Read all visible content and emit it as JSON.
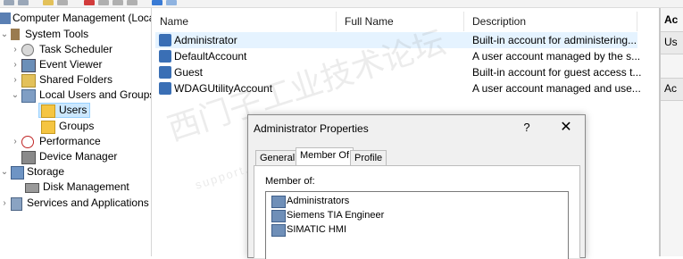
{
  "tree": {
    "root": "Computer Management (Local",
    "items": [
      {
        "label": "System Tools",
        "icon": "tools-icon"
      },
      {
        "label": "Task Scheduler",
        "icon": "clock-icon"
      },
      {
        "label": "Event Viewer",
        "icon": "event-viewer-icon"
      },
      {
        "label": "Shared Folders",
        "icon": "shared-folder-icon"
      },
      {
        "label": "Local Users and Groups",
        "icon": "users-groups-icon"
      },
      {
        "label": "Users",
        "icon": "folder-icon"
      },
      {
        "label": "Groups",
        "icon": "folder-icon"
      },
      {
        "label": "Performance",
        "icon": "performance-icon"
      },
      {
        "label": "Device Manager",
        "icon": "device-manager-icon"
      },
      {
        "label": "Storage",
        "icon": "storage-icon"
      },
      {
        "label": "Disk Management",
        "icon": "disk-icon"
      },
      {
        "label": "Services and Applications",
        "icon": "services-icon"
      }
    ]
  },
  "list": {
    "columns": {
      "name": "Name",
      "full_name": "Full Name",
      "description": "Description"
    },
    "rows": [
      {
        "name": "Administrator",
        "full_name": "",
        "description": "Built-in account for administering..."
      },
      {
        "name": "DefaultAccount",
        "full_name": "",
        "description": "A user account managed by the s..."
      },
      {
        "name": "Guest",
        "full_name": "",
        "description": "Built-in account for guest access t..."
      },
      {
        "name": "WDAGUtilityAccount",
        "full_name": "",
        "description": "A user account managed and use..."
      }
    ]
  },
  "actions": {
    "header": "Ac",
    "item1": "Us",
    "item2": "Ac"
  },
  "dialog": {
    "title": "Administrator Properties",
    "help": "?",
    "close": "✕",
    "tabs": [
      "General",
      "Member Of",
      "Profile"
    ],
    "active_tab": "Member Of",
    "member_of_label": "Member of:",
    "members": [
      "Administrators",
      "Siemens TIA Engineer",
      "SIMATIC HMI"
    ]
  },
  "watermark": {
    "text": "西门子工业技术论坛",
    "subtext": "support.industry.siemens.com"
  },
  "colors": {
    "selection": "#cce8ff",
    "row_selected": "#e5f3ff",
    "folder": "#f5c542",
    "user_icon": "#3a6fb5"
  }
}
